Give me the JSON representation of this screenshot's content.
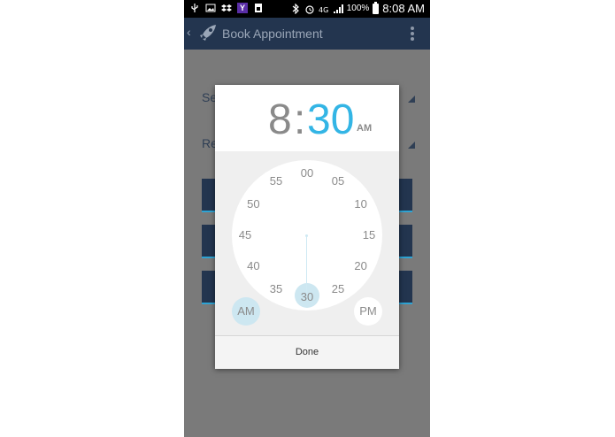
{
  "status_bar": {
    "battery_percent": "100%",
    "time": "8:08 AM",
    "yahoo_label": "Y",
    "left_icons": [
      "usb-icon",
      "image-icon",
      "dropbox-icon",
      "yahoo-icon",
      "sim-icon"
    ],
    "right_icons": [
      "bluetooth-icon",
      "alarm-icon",
      "4g-icon",
      "signal-icon",
      "battery-icon"
    ]
  },
  "action_bar": {
    "back_glyph": "‹",
    "title": "Book Appointment",
    "logo_icon": "rocket-icon",
    "menu_icon": "overflow-menu-icon"
  },
  "background_form": {
    "field1_hint": "Se",
    "field2_hint": "Re"
  },
  "time_picker": {
    "hour": "8",
    "separator": ":",
    "minute": "30",
    "period": "AM",
    "minute_labels": [
      "00",
      "05",
      "10",
      "15",
      "20",
      "25",
      "30",
      "35",
      "40",
      "45",
      "50",
      "55"
    ],
    "selected_minute": "30",
    "am_label": "AM",
    "pm_label": "PM",
    "done_label": "Done",
    "accent_color": "#33b5e5",
    "selection_color": "#cde7f1"
  }
}
